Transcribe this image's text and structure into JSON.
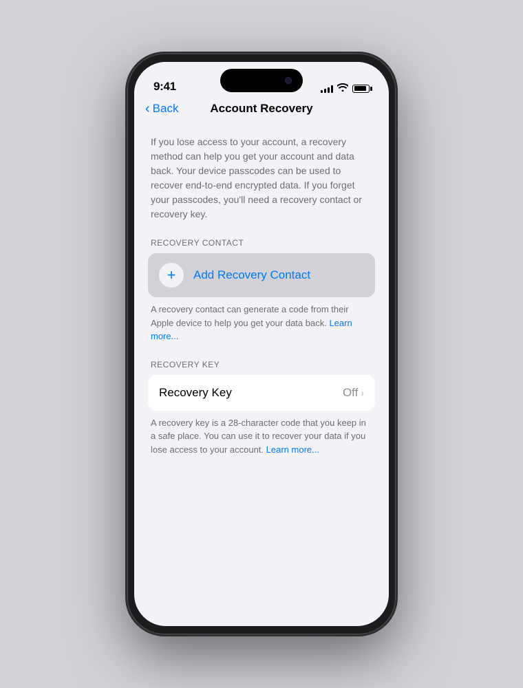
{
  "statusBar": {
    "time": "9:41",
    "signalBars": [
      4,
      6,
      8,
      10,
      12
    ],
    "batteryLevel": 85
  },
  "navigation": {
    "backLabel": "Back",
    "pageTitle": "Account Recovery"
  },
  "content": {
    "introText": "If you lose access to your account, a recovery method can help you get your account and data back. Your device passcodes can be used to recover end-to-end encrypted data. If you forget your passcodes, you'll need a recovery contact or recovery key.",
    "recoveryContactSection": {
      "sectionLabel": "RECOVERY CONTACT",
      "addButtonLabel": "Add Recovery Contact",
      "footerText": "A recovery contact can generate a code from their Apple device to help you get your data back. ",
      "learnMoreLabel": "Learn more..."
    },
    "recoveryKeySection": {
      "sectionLabel": "RECOVERY KEY",
      "rowLabel": "Recovery Key",
      "statusLabel": "Off",
      "footerText": "A recovery key is a 28-character code that you keep in a safe place. You can use it to recover your data if you lose access to your account. ",
      "learnMoreLabel": "Learn more..."
    }
  }
}
